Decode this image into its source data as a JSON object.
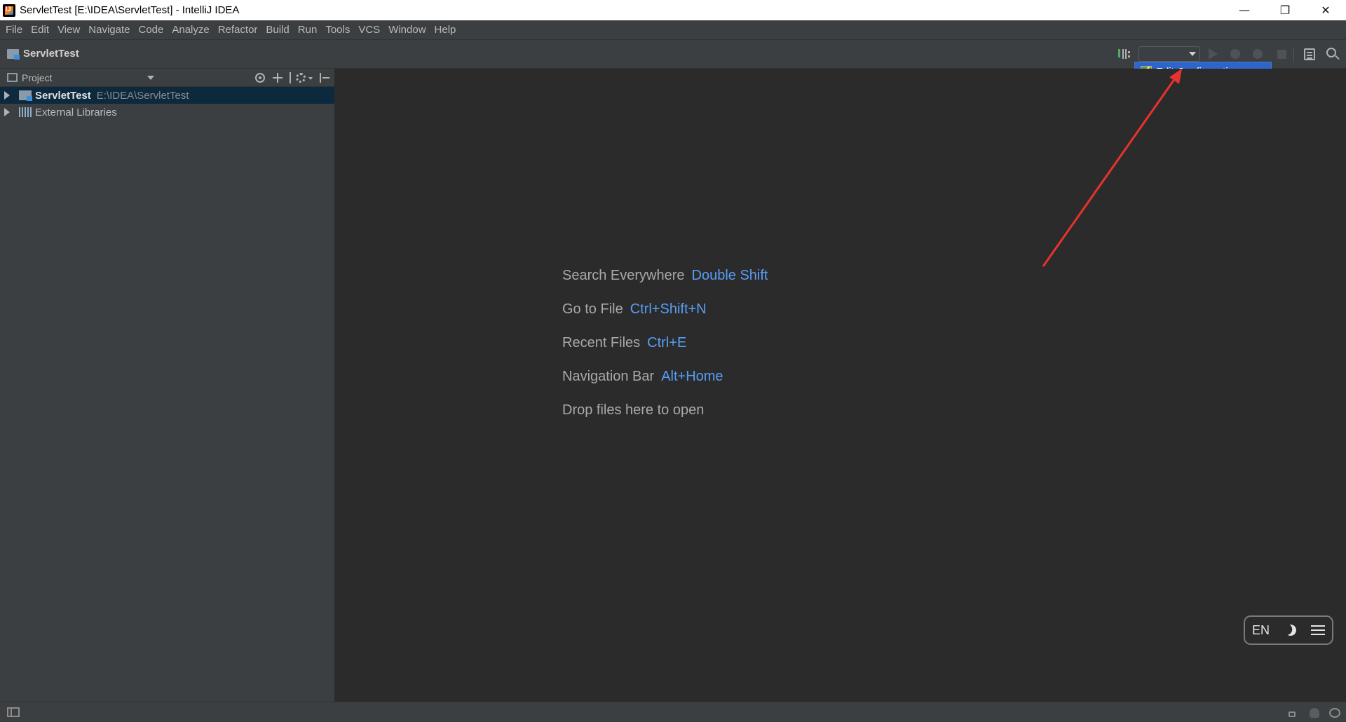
{
  "window": {
    "title": "ServletTest [E:\\IDEA\\ServletTest] - IntelliJ IDEA",
    "controls": {
      "minimize": "—",
      "restore": "❐",
      "close": "✕"
    }
  },
  "menu": {
    "items": [
      "File",
      "Edit",
      "View",
      "Navigate",
      "Code",
      "Analyze",
      "Refactor",
      "Build",
      "Run",
      "Tools",
      "VCS",
      "Window",
      "Help"
    ]
  },
  "navbar": {
    "breadcrumb": "ServletTest",
    "run_config_value": ""
  },
  "popup": {
    "label": "Edit Configurations..."
  },
  "project_panel": {
    "title": "Project",
    "tree": [
      {
        "label": "ServletTest",
        "path": "E:\\IDEA\\ServletTest",
        "selected": true
      },
      {
        "label": "External Libraries"
      }
    ]
  },
  "editor": {
    "hints": [
      {
        "text": "Search Everywhere",
        "shortcut": "Double Shift"
      },
      {
        "text": "Go to File",
        "shortcut": "Ctrl+Shift+N"
      },
      {
        "text": "Recent Files",
        "shortcut": "Ctrl+E"
      },
      {
        "text": "Navigation Bar",
        "shortcut": "Alt+Home"
      },
      {
        "text": "Drop files here to open",
        "shortcut": ""
      }
    ]
  },
  "lang_widget": {
    "label": "EN"
  },
  "colors": {
    "background": "#2b2b2b",
    "panel": "#3c3f41",
    "selection": "#0d293e",
    "popup_selection": "#2f65ca",
    "shortcut": "#589df6",
    "annotation_arrow": "#e8322f"
  },
  "icons": [
    "app-icon",
    "folder-icon",
    "build-icon",
    "run-icon",
    "debug-icon",
    "coverage-icon",
    "stop-icon",
    "structure-icon",
    "search-icon",
    "edit-icon",
    "locate-icon",
    "collapse-all-icon",
    "gear-icon",
    "hide-icon",
    "module-icon",
    "library-icon",
    "moon-icon",
    "menu-icon",
    "lock-icon",
    "inspector-icon",
    "event-log-icon"
  ]
}
